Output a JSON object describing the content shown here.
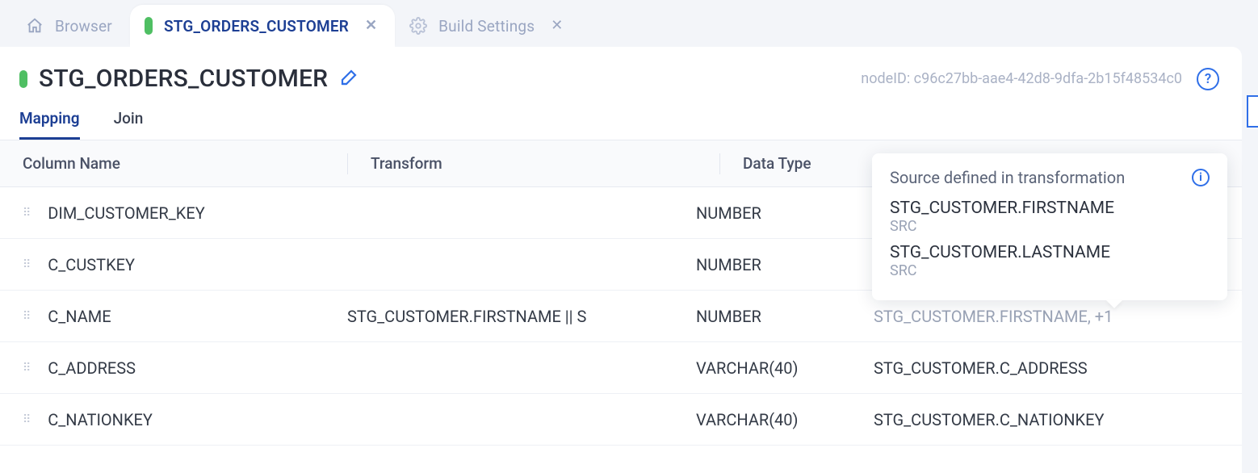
{
  "tabs": {
    "browser": {
      "label": "Browser"
    },
    "node": {
      "label": "STG_ORDERS_CUSTOMER"
    },
    "build": {
      "label": "Build Settings"
    }
  },
  "header": {
    "title": "STG_ORDERS_CUSTOMER",
    "node_id_label": "nodeID: c96c27bb-aae4-42d8-9dfa-2b15f48534c0"
  },
  "subtabs": {
    "mapping": "Mapping",
    "join": "Join"
  },
  "table": {
    "headers": {
      "name": "Column Name",
      "transform": "Transform",
      "type": "Data Type"
    },
    "rows": [
      {
        "name": "DIM_CUSTOMER_KEY",
        "transform": "",
        "type": "NUMBER",
        "source": ""
      },
      {
        "name": "C_CUSTKEY",
        "transform": "",
        "type": "NUMBER",
        "source": ""
      },
      {
        "name": "C_NAME",
        "transform": "STG_CUSTOMER.FIRSTNAME || S",
        "type": "NUMBER",
        "source": "STG_CUSTOMER.FIRSTNAME, +1"
      },
      {
        "name": "C_ADDRESS",
        "transform": "",
        "type": "VARCHAR(40)",
        "source": "STG_CUSTOMER.C_ADDRESS"
      },
      {
        "name": "C_NATIONKEY",
        "transform": "",
        "type": "VARCHAR(40)",
        "source": "STG_CUSTOMER.C_NATIONKEY"
      }
    ]
  },
  "popover": {
    "title": "Source defined in transformation",
    "entries": [
      {
        "name": "STG_CUSTOMER.FIRSTNAME",
        "sub": "SRC"
      },
      {
        "name": "STG_CUSTOMER.LASTNAME",
        "sub": "SRC"
      }
    ]
  }
}
